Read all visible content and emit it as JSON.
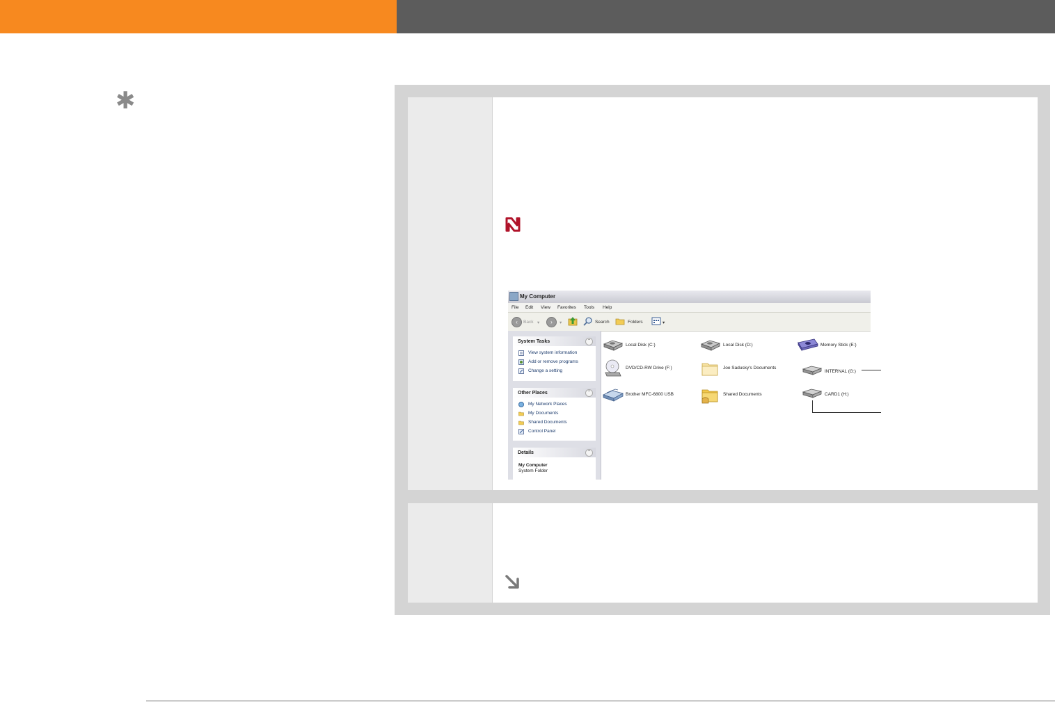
{
  "colors": {
    "header_orange": "#f7891f",
    "header_gray": "#5c5c5c",
    "frame_gray": "#d4d4d4",
    "note_red": "#b0132a",
    "arrow_gray": "#7a7a7a"
  },
  "icons": {
    "tip": "asterisk-icon",
    "note": "note-icon",
    "continue": "arrow-down-right-icon"
  },
  "tip": {
    "glyph": "✱"
  },
  "window": {
    "title": "My Computer",
    "menu": [
      "File",
      "Edit",
      "View",
      "Favorites",
      "Tools",
      "Help"
    ],
    "toolbar": {
      "back": "Back",
      "search": "Search",
      "folders": "Folders"
    },
    "system_tasks": {
      "title": "System Tasks",
      "items": [
        "View system information",
        "Add or remove programs",
        "Change a setting"
      ]
    },
    "other_places": {
      "title": "Other Places",
      "items": [
        "My Network Places",
        "My Documents",
        "Shared Documents",
        "Control Panel"
      ]
    },
    "details": {
      "title": "Details",
      "name": "My Computer",
      "type": "System Folder"
    },
    "drives": [
      "Local Disk (C:)",
      "Local Disk (D:)",
      "Memory Stick (E:)",
      "DVD/CD-RW Drive (F:)",
      "Joe Sadusky's Documents",
      "INTERNAL (G:)",
      "Brother MFC-6800 USB",
      "Shared Documents",
      "CARD1 (H:)"
    ]
  }
}
